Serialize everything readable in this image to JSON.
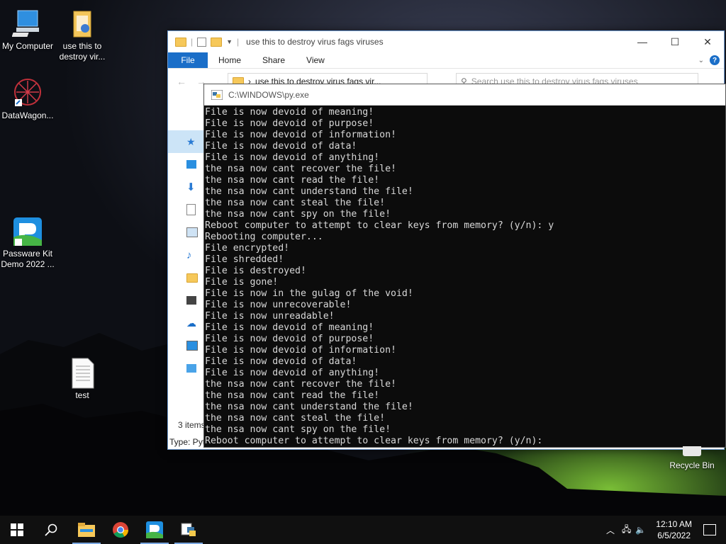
{
  "desktop": {
    "icons": [
      {
        "label": "My Computer"
      },
      {
        "label": "use this to destroy vir..."
      },
      {
        "label": "DataWagon..."
      },
      {
        "label": "Passware Kit Demo 2022 ..."
      },
      {
        "label": "test"
      }
    ],
    "recycle_bin": "Recycle Bin"
  },
  "explorer": {
    "title": "use this to destroy virus fags viruses",
    "ribbon": {
      "file": "File",
      "home": "Home",
      "share": "Share",
      "view": "View",
      "help": "?"
    },
    "address": "use this to destroy virus fags vir...",
    "search_placeholder": "Search use this to destroy virus fags viruses",
    "status_items": "3 items",
    "status_type": "Type: Pytl"
  },
  "console": {
    "title": "C:\\WINDOWS\\py.exe",
    "lines": [
      "File is now devoid of meaning!",
      "File is now devoid of purpose!",
      "File is now devoid of information!",
      "File is now devoid of data!",
      "File is now devoid of anything!",
      "the nsa now cant recover the file!",
      "the nsa now cant read the file!",
      "the nsa now cant understand the file!",
      "the nsa now cant steal the file!",
      "the nsa now cant spy on the file!",
      "Reboot computer to attempt to clear keys from memory? (y/n): y",
      "Rebooting computer...",
      "File encrypted!",
      "File shredded!",
      "File is destroyed!",
      "File is gone!",
      "File is now in the gulag of the void!",
      "File is now unrecoverable!",
      "File is now unreadable!",
      "File is now devoid of meaning!",
      "File is now devoid of purpose!",
      "File is now devoid of information!",
      "File is now devoid of data!",
      "File is now devoid of anything!",
      "the nsa now cant recover the file!",
      "the nsa now cant read the file!",
      "the nsa now cant understand the file!",
      "the nsa now cant steal the file!",
      "the nsa now cant spy on the file!",
      "Reboot computer to attempt to clear keys from memory? (y/n):"
    ]
  },
  "taskbar": {
    "time": "12:10 AM",
    "date": "6/5/2022"
  },
  "colors": {
    "accent": "#1a6ec8",
    "console_bg": "#0c0c0c",
    "console_text": "#d8d8d8",
    "taskbar": "#101010"
  }
}
